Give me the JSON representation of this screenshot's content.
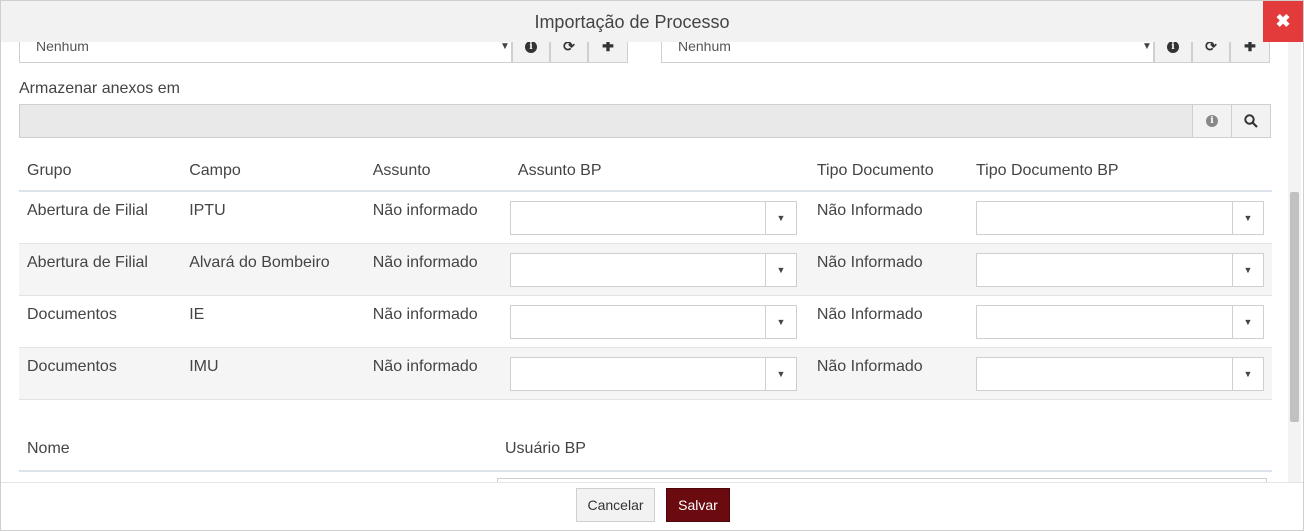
{
  "dialog": {
    "title": "Importação de Processo",
    "close_symbol": "✖"
  },
  "top_selects": [
    {
      "value": "Nenhum"
    },
    {
      "value": "Nenhum"
    }
  ],
  "addon_icons": [
    "info-icon",
    "refresh-icon",
    "plus-icon"
  ],
  "attachments": {
    "label": "Armazenar anexos em",
    "value": ""
  },
  "mapping_table": {
    "headers": [
      "Grupo",
      "Campo",
      "Assunto",
      "Assunto BP",
      "Tipo Documento",
      "Tipo Documento BP"
    ],
    "rows": [
      {
        "grupo": "Abertura de Filial",
        "campo": "IPTU",
        "assunto": "Não informado",
        "assunto_bp": "",
        "tipo_documento": "Não Informado",
        "tipo_documento_bp": ""
      },
      {
        "grupo": "Abertura de Filial",
        "campo": "Alvará do Bombeiro",
        "assunto": "Não informado",
        "assunto_bp": "",
        "tipo_documento": "Não Informado",
        "tipo_documento_bp": ""
      },
      {
        "grupo": "Documentos",
        "campo": "IE",
        "assunto": "Não informado",
        "assunto_bp": "",
        "tipo_documento": "Não Informado",
        "tipo_documento_bp": ""
      },
      {
        "grupo": "Documentos",
        "campo": "IMU",
        "assunto": "Não informado",
        "assunto_bp": "",
        "tipo_documento": "Não Informado",
        "tipo_documento_bp": ""
      }
    ]
  },
  "users_table": {
    "headers": [
      "Nome",
      "Usuário BP"
    ]
  },
  "footer": {
    "cancel_label": "Cancelar",
    "save_label": "Salvar"
  },
  "colors": {
    "close_button": "#e33b3b",
    "save_button": "#6b0b10"
  }
}
